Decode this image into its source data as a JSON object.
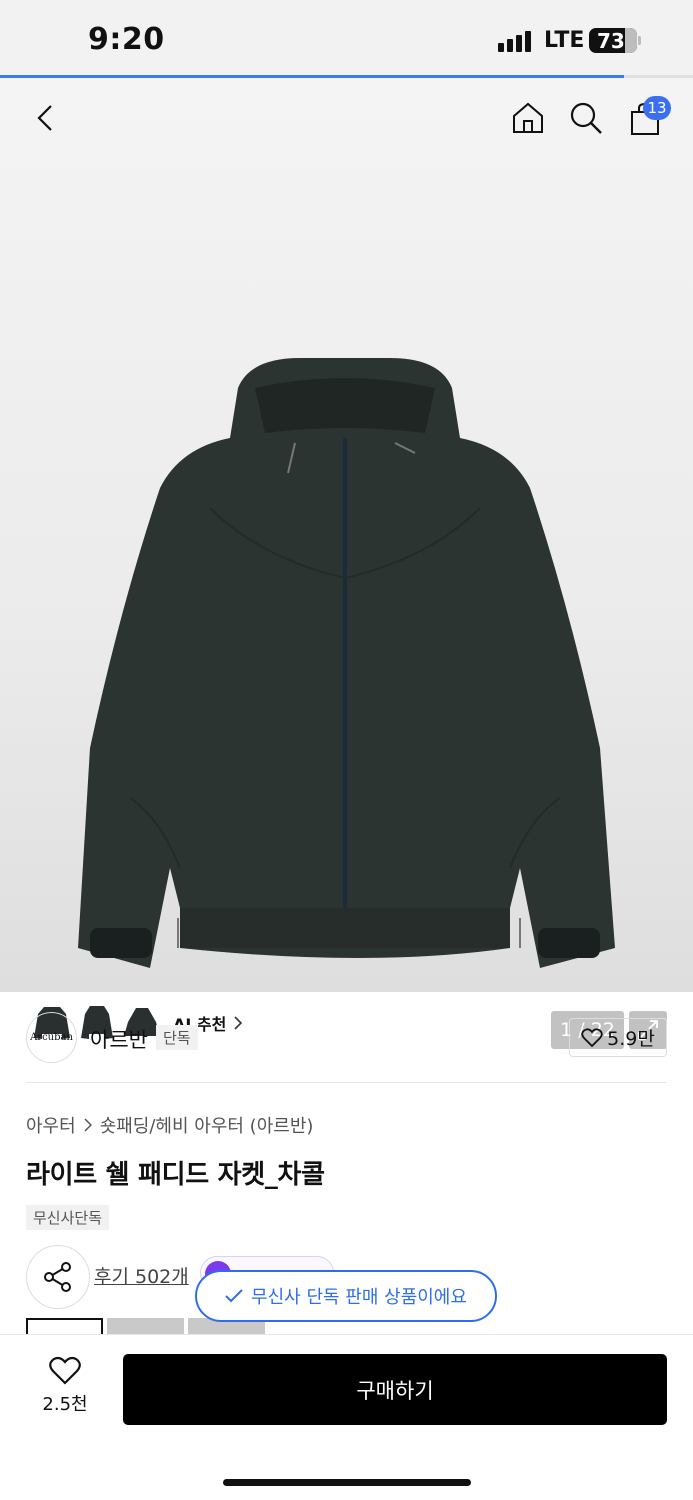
{
  "status_bar": {
    "time": "9:20",
    "network": "LTE",
    "battery": "73"
  },
  "page_progress": 0.9,
  "header": {
    "cart_count": "13"
  },
  "gallery": {
    "ai_label": "AI 추천",
    "counter": "1 / 22"
  },
  "brand": {
    "logo_text": "Arcuban",
    "name": "아르반",
    "tag": "단독",
    "likes": "5.9만"
  },
  "product": {
    "breadcrumb": [
      "아우터",
      "숏패딩/헤비 아우터 (아르반)"
    ],
    "title": "라이트 쉘 패디드 자켓_차콜",
    "exclusive_tag": "무신사단독",
    "reviews": "후기 502개"
  },
  "toast": "무신사 단독 판매 상품이에요",
  "bottom": {
    "wish_count": "2.5천",
    "buy_label": "구매하기"
  },
  "colors": {
    "accent": "#2f6ee8",
    "jacket": "#2c3432",
    "buy_button": "#000000"
  }
}
